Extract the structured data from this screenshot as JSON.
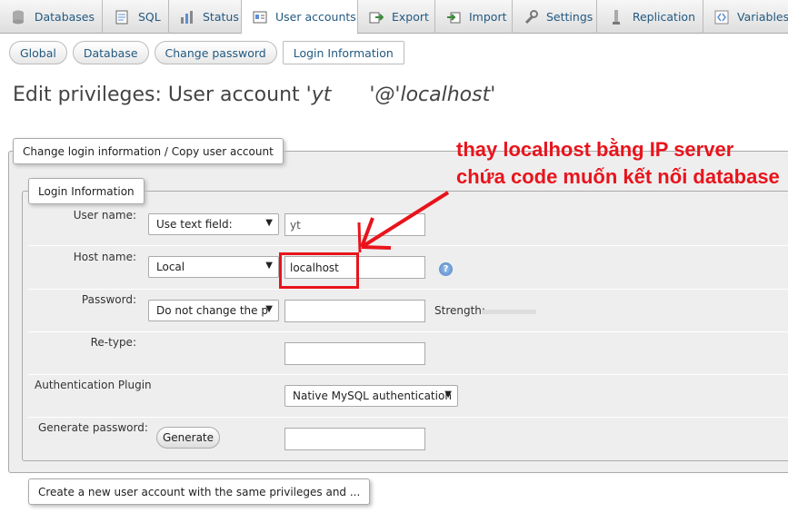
{
  "top_tabs": [
    {
      "label": "Databases",
      "icon": "database-icon"
    },
    {
      "label": "SQL",
      "icon": "sql-icon"
    },
    {
      "label": "Status",
      "icon": "status-icon"
    },
    {
      "label": "User accounts",
      "icon": "user-accounts-icon",
      "active": true
    },
    {
      "label": "Export",
      "icon": "export-icon"
    },
    {
      "label": "Import",
      "icon": "import-icon"
    },
    {
      "label": "Settings",
      "icon": "wrench-icon"
    },
    {
      "label": "Replication",
      "icon": "replication-icon"
    },
    {
      "label": "Variables",
      "icon": "variables-icon"
    }
  ],
  "sub_tabs": [
    {
      "label": "Global"
    },
    {
      "label": "Database"
    },
    {
      "label": "Change password"
    },
    {
      "label": "Login Information",
      "active": true
    }
  ],
  "page_title": {
    "prefix": "Edit privileges: User account ",
    "user": "'yt",
    "host": "'@'localhost'"
  },
  "fieldset_outer_legend": "Change login information / Copy user account",
  "fieldset_inner_legend": "Login Information",
  "form": {
    "user_name": {
      "label": "User name:",
      "select": "Use text field:",
      "value": "yt"
    },
    "host_name": {
      "label": "Host name:",
      "select": "Local",
      "value": "localhost"
    },
    "password": {
      "label": "Password:",
      "select": "Do not change the p",
      "value": "",
      "strength_label": "Strength:"
    },
    "retype": {
      "label": "Re-type:",
      "value": ""
    },
    "auth_plugin": {
      "label": "Authentication Plugin",
      "select": "Native MySQL authentication"
    },
    "generate": {
      "label": "Generate password:",
      "button": "Generate",
      "value": ""
    }
  },
  "next_legend": "Create a new user account with the same privileges and ...",
  "annotation": {
    "text": "thay localhost bằng IP server chứa code muốn kết nối database",
    "color": "#e8141c"
  },
  "help_icon": "?"
}
